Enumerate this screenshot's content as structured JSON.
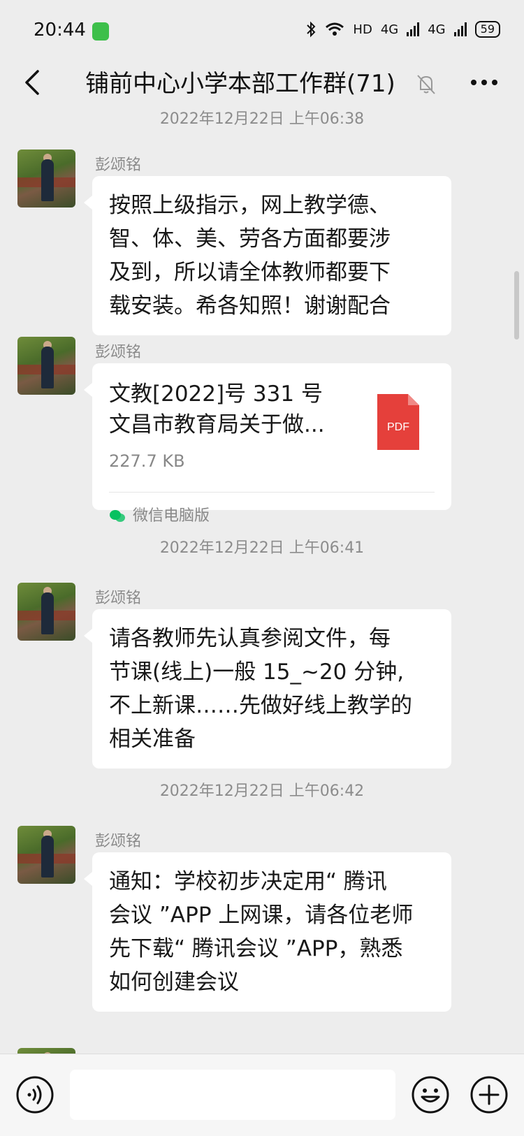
{
  "status_bar": {
    "time": "20:44",
    "network": "HD",
    "signal_1": "4G",
    "signal_2": "4G",
    "battery": "59"
  },
  "nav": {
    "title": "铺前中心小学本部工作群(71)",
    "back_icon": "chevron-left-icon",
    "mute_icon": "bell-muted-icon",
    "more_icon": "more-dots-icon"
  },
  "messages": [
    {
      "type": "timestamp",
      "text": "2022年12月22日 上午06:38"
    },
    {
      "type": "text",
      "sender": "彭颂铭",
      "lines": [
        "按照上级指示，网上教学德、",
        "智、体、美、劳各方面都要涉",
        "及到，所以请全体教师都要下",
        "载安装。希各知照！谢谢配合"
      ]
    },
    {
      "type": "file",
      "sender": "彭颂铭",
      "title_line1": "文教[2022]号 331 号",
      "title_line2": "文昌市教育局关于做...",
      "size": "227.7 KB",
      "file_type": "PDF",
      "source": "微信电脑版"
    },
    {
      "type": "timestamp",
      "text": "2022年12月22日 上午06:41"
    },
    {
      "type": "text",
      "sender": "彭颂铭",
      "lines": [
        "请各教师先认真参阅文件，每",
        "节课(线上)一般 15_~20 分钟,",
        "不上新课……先做好线上教学的",
        "相关准备"
      ]
    },
    {
      "type": "timestamp",
      "text": "2022年12月22日 上午06:42"
    },
    {
      "type": "text",
      "sender": "彭颂铭",
      "lines": [
        "通知：学校初步决定用“ 腾讯",
        "会议 ”APP 上网课，请各位老师",
        "先下载“ 腾讯会议 ”APP，熟悉",
        "如何创建会议"
      ]
    }
  ],
  "input_bar": {
    "voice_icon": "voice-icon",
    "emoji_icon": "emoji-icon",
    "plus_icon": "plus-icon"
  },
  "colors": {
    "background": "#ededed",
    "bubble": "#ffffff",
    "pdf_red": "#e5403b",
    "wechat_green": "#07c160"
  }
}
